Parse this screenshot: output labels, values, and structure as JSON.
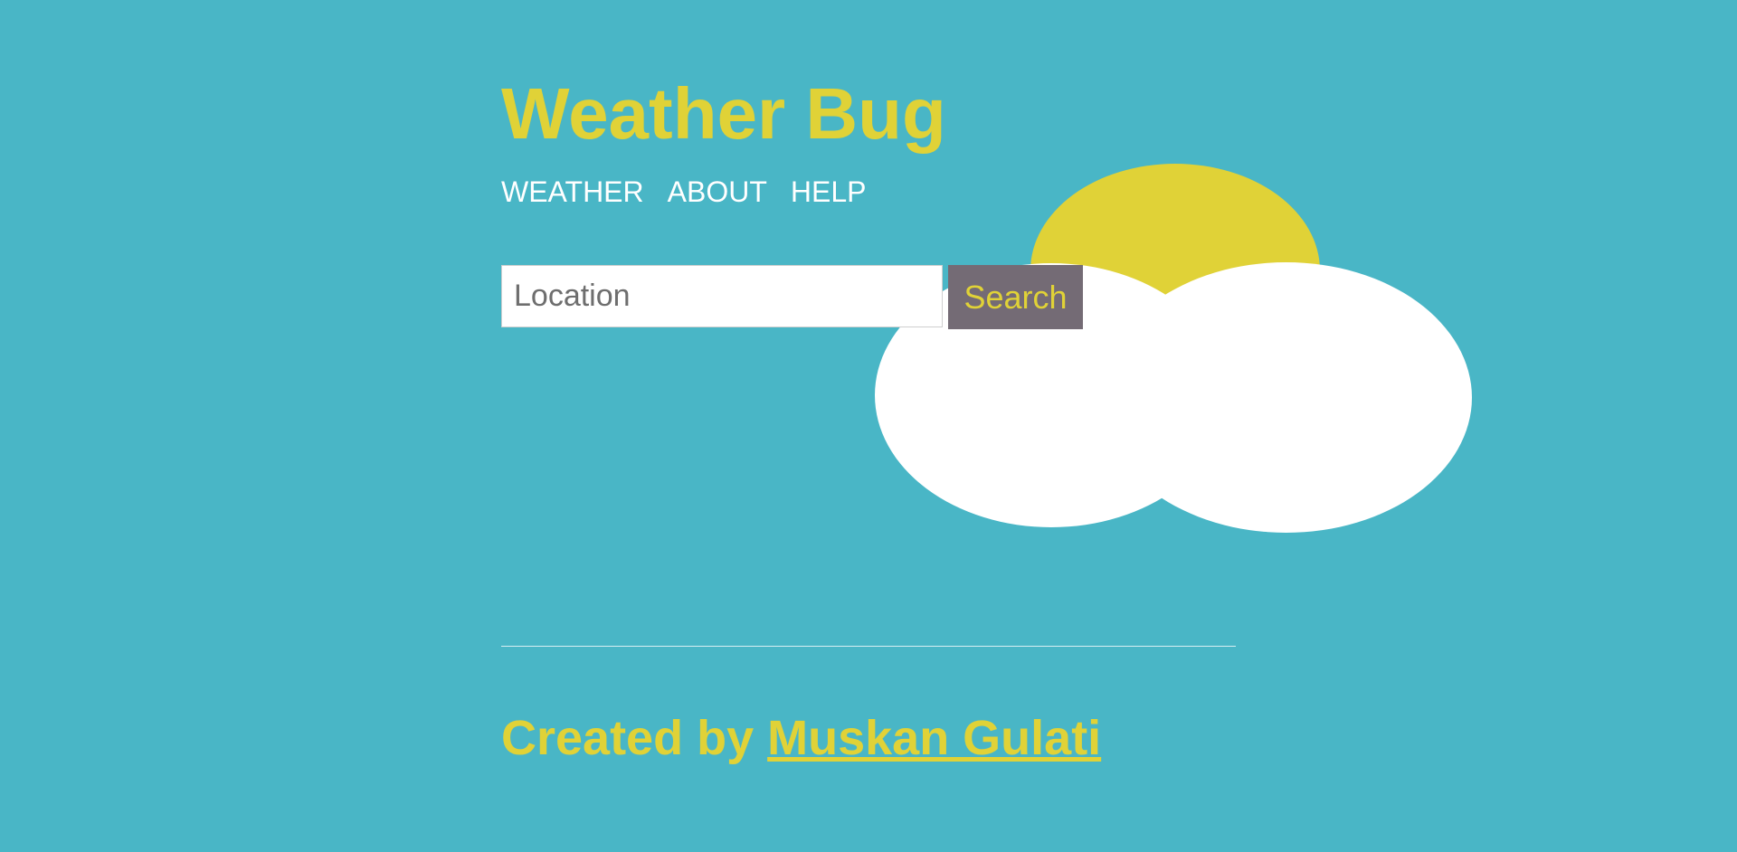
{
  "header": {
    "title": "Weather Bug"
  },
  "nav": {
    "items": [
      "WEATHER",
      "ABOUT",
      "HELP"
    ]
  },
  "search": {
    "placeholder": "Location",
    "value": "",
    "button_label": "Search"
  },
  "footer": {
    "prefix": "Created by",
    "author_name": "Muskan Gulati"
  },
  "theme": {
    "background": "#49b6c6",
    "accent": "#e0d237",
    "button_bg": "#746b75",
    "nav_text": "#ffffff"
  },
  "icons": {
    "illustration": "sun-behind-cloud-icon"
  }
}
